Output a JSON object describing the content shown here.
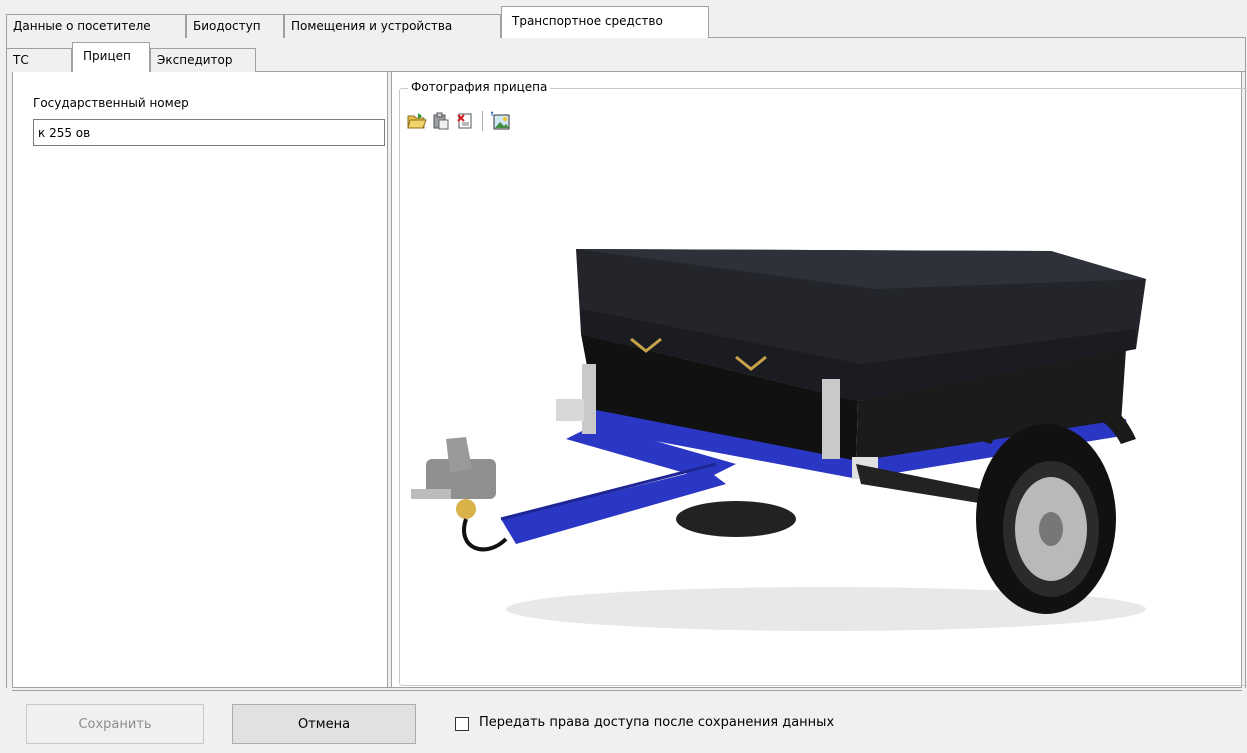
{
  "tabs": [
    {
      "label": "Данные о посетителе"
    },
    {
      "label": "Биодоступ"
    },
    {
      "label": "Помещения и устройства"
    },
    {
      "label": "Транспортное средство"
    }
  ],
  "subtabs": [
    {
      "label": "ТС"
    },
    {
      "label": "Прицеп"
    },
    {
      "label": "Экспедитор"
    }
  ],
  "left": {
    "field_label": "Государственный номер",
    "field_value": "к 255 ов"
  },
  "photo": {
    "legend": "Фотография прицепа",
    "toolbar": [
      "open-folder-icon",
      "paste-icon",
      "clear-icon",
      "image-settings-icon"
    ]
  },
  "footer": {
    "save_label": "Сохранить",
    "cancel_label": "Отмена",
    "checkbox_label": "Передать права доступа после сохранения данных",
    "checkbox_checked": false
  },
  "colors": {
    "trailer_frame": "#2a36c4",
    "tarp": "#23252b"
  }
}
